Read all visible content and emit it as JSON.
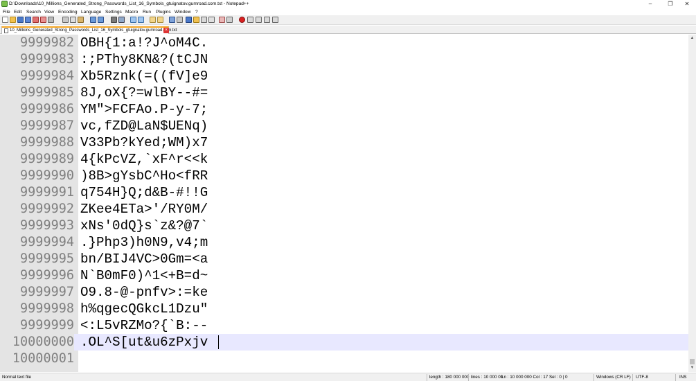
{
  "window": {
    "title": "D:\\Downloads\\10_Millions_Generated_Strong_Passwords_List_16_Symbols_gtuignatov.gumroad.com.txt - Notepad++",
    "minimize_icon": "minimize-icon",
    "maximize_icon": "restore-icon",
    "close_icon": "close-icon"
  },
  "menu": [
    {
      "label": "File"
    },
    {
      "label": "Edit"
    },
    {
      "label": "Search"
    },
    {
      "label": "View"
    },
    {
      "label": "Encoding"
    },
    {
      "label": "Language"
    },
    {
      "label": "Settings"
    },
    {
      "label": "Macro"
    },
    {
      "label": "Run"
    },
    {
      "label": "Plugins"
    },
    {
      "label": "Window"
    },
    {
      "label": "?"
    }
  ],
  "toolbar": {
    "icons": [
      "new-file-icon",
      "open-file-icon",
      "save-icon",
      "save-all-icon",
      "close-icon",
      "close-all-icon",
      "print-icon",
      "cut-icon",
      "copy-icon",
      "paste-icon",
      "undo-icon",
      "redo-icon",
      "find-icon",
      "replace-icon",
      "zoom-in-icon",
      "zoom-out-icon",
      "sync-vertical-icon",
      "sync-horizontal-icon",
      "word-wrap-icon",
      "show-all-chars-icon",
      "indent-guide-icon",
      "user-language-icon",
      "document-map-icon",
      "function-list-icon",
      "folder-workspace-icon",
      "monitoring-icon",
      "record-macro-icon",
      "stop-record-icon",
      "play-macro-icon",
      "run-macro-multiple-icon",
      "save-macro-icon"
    ]
  },
  "tab": {
    "label": "10_Millions_Generated_Strong_Passwords_List_16_Symbols_gtuignatov.gumroad.com.txt",
    "close_icon": "tab-close-icon"
  },
  "editor": {
    "lines": [
      {
        "no": "9999982",
        "text": "OBH{1:a!?J^oM4C."
      },
      {
        "no": "9999983",
        "text": ":;PThy8KN&?(tCJN"
      },
      {
        "no": "9999984",
        "text": "Xb5Rznk(=((fV]e9"
      },
      {
        "no": "9999985",
        "text": "8J,oX{?=wlBY--#="
      },
      {
        "no": "9999986",
        "text": "YM\">FCFAo.P-y-7;"
      },
      {
        "no": "9999987",
        "text": "vc,fZD@LaN$UENq)"
      },
      {
        "no": "9999988",
        "text": "V33Pb?kYed;WM)x7"
      },
      {
        "no": "9999989",
        "text": "4{kPcVZ,`xF^r<<k"
      },
      {
        "no": "9999990",
        "text": ")8B>gYsbC^Ho<fRR"
      },
      {
        "no": "9999991",
        "text": "q754H}Q;d&B-#!!G"
      },
      {
        "no": "9999992",
        "text": "ZKee4ETa>'/RY0M/"
      },
      {
        "no": "9999993",
        "text": "xNs'0dQ}s`z&?@7`"
      },
      {
        "no": "9999994",
        "text": ".}Php3)h0N9,v4;m"
      },
      {
        "no": "9999995",
        "text": "bn/BIJ4VC>0Gm=<a"
      },
      {
        "no": "9999996",
        "text": "N`B0mF0)^1<+B=d~"
      },
      {
        "no": "9999997",
        "text": "O9.8-@-pnfv>:=ke"
      },
      {
        "no": "9999998",
        "text": "h%qgecQGkcL1Dzu\""
      },
      {
        "no": "9999999",
        "text": "<:L5vRZMo?{`B:--"
      },
      {
        "no": "10000000",
        "text": ".OL^S[ut&u6zPxjv"
      },
      {
        "no": "10000001",
        "text": ""
      }
    ],
    "current_line_index": 18
  },
  "status": {
    "file_type": "Normal text file",
    "length": "length : 180 000 000",
    "lines": "lines : 10 000 00",
    "position": "Ln : 10 000 000    Col : 17    Sel : 0 | 0",
    "eol": "Windows (CR LF)",
    "encoding": "UTF-8",
    "mode": "INS"
  }
}
